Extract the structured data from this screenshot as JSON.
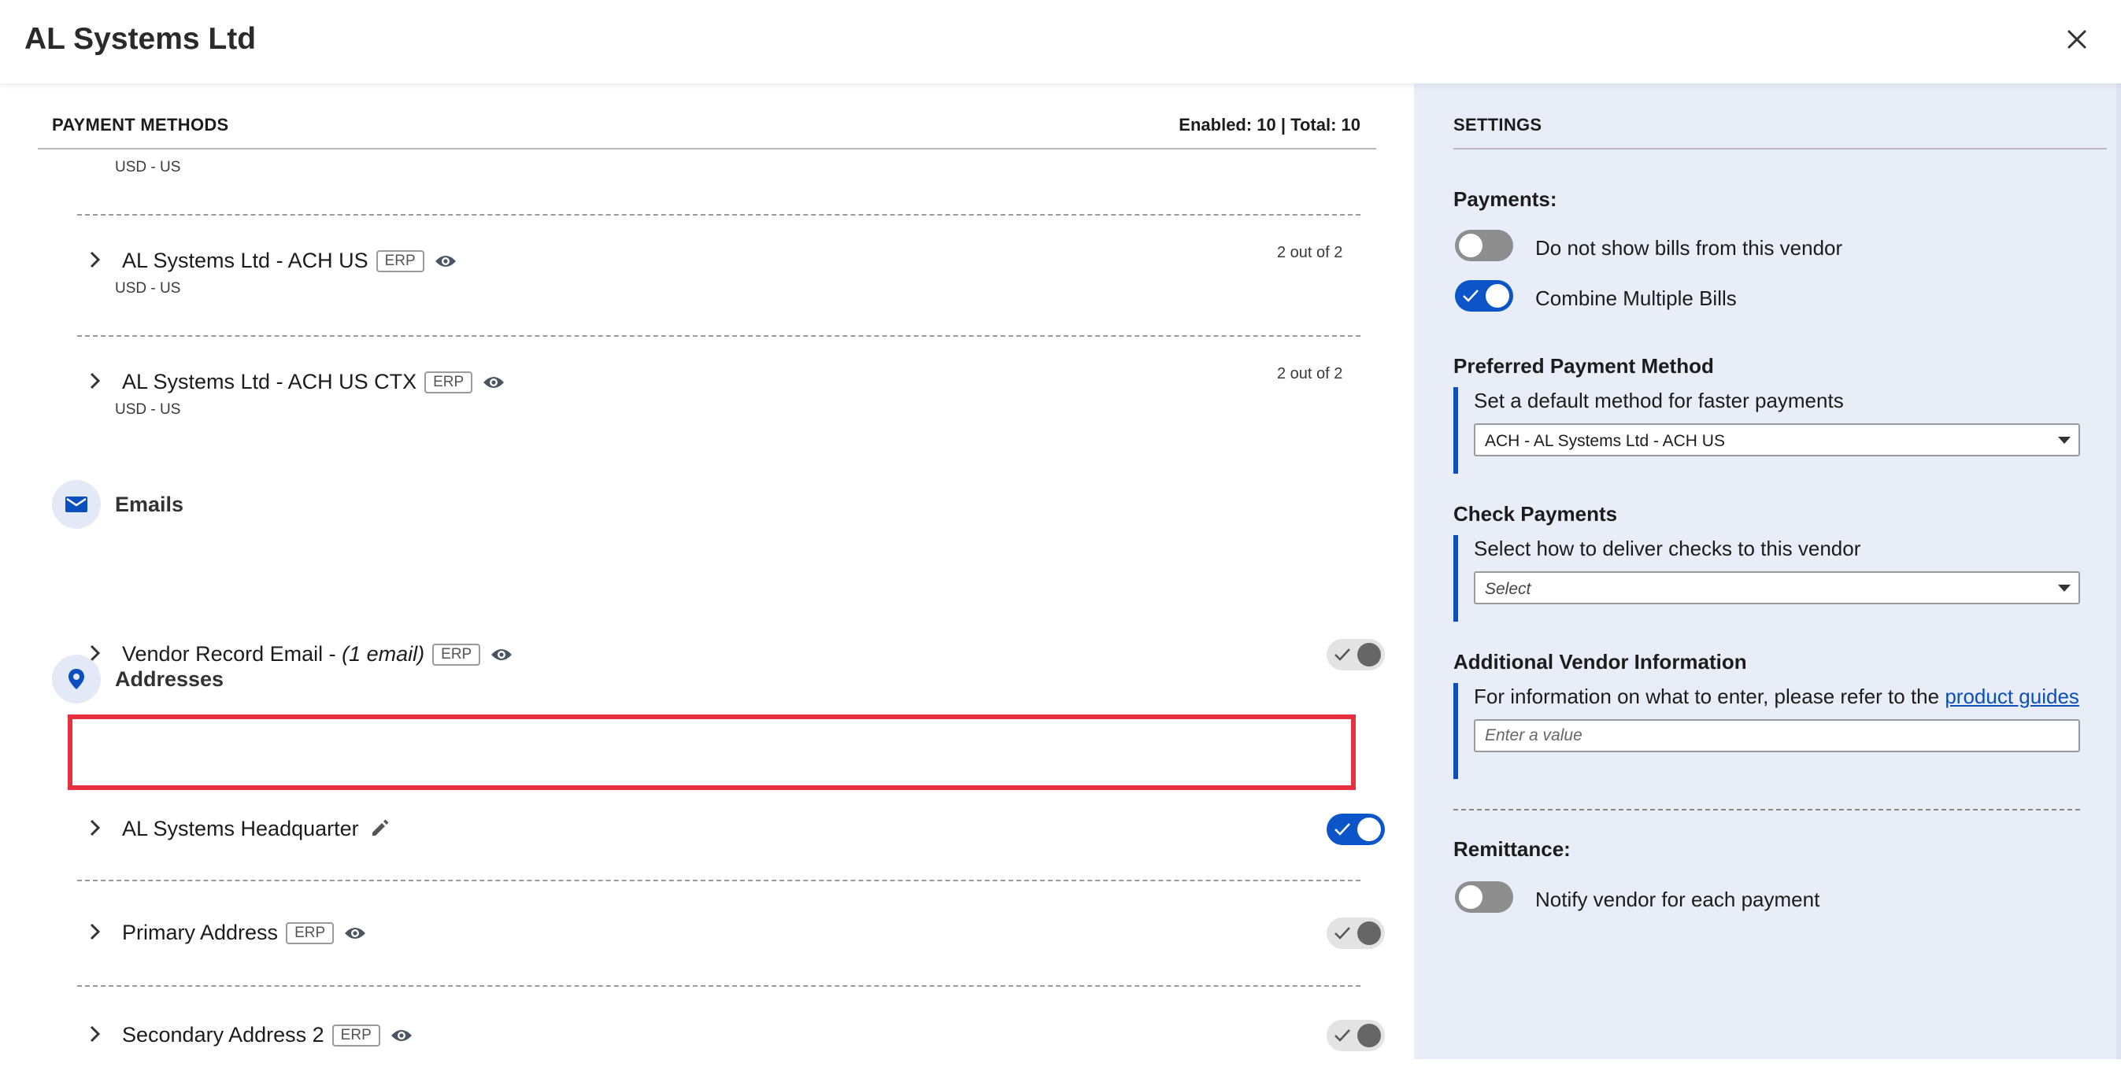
{
  "header": {
    "title": "AL Systems Ltd"
  },
  "payment_methods": {
    "heading": "PAYMENT METHODS",
    "counts": "Enabled: 10  |  Total: 10",
    "partial_sub": "USD - US",
    "rows": [
      {
        "label": "AL Systems Ltd - ACH US",
        "badge": "ERP",
        "sub": "USD - US",
        "out_of": "2 out of 2"
      },
      {
        "label": "AL Systems Ltd - ACH US CTX",
        "badge": "ERP",
        "sub": "USD - US",
        "out_of": "2 out of 2"
      }
    ]
  },
  "emails": {
    "heading": "Emails",
    "rows": [
      {
        "label": "Vendor Record Email - ",
        "label_italic": "(1 email)",
        "badge": "ERP"
      }
    ]
  },
  "addresses": {
    "heading": "Addresses",
    "rows": [
      {
        "label": "AL Systems Headquarter",
        "enabled": true
      },
      {
        "label": "Primary Address",
        "badge": "ERP"
      },
      {
        "label": "Secondary Address 2",
        "badge": "ERP"
      }
    ]
  },
  "settings": {
    "heading": "SETTINGS",
    "payments_label": "Payments:",
    "toggle_hide_bills": "Do not show bills from this vendor",
    "toggle_combine": "Combine Multiple Bills",
    "preferred": {
      "label": "Preferred Payment Method",
      "help": "Set a default method for faster payments",
      "value": "ACH - AL Systems Ltd - ACH US"
    },
    "check": {
      "label": "Check Payments",
      "help": "Select how to deliver checks to this vendor",
      "value": "Select"
    },
    "additional": {
      "label": "Additional Vendor Information",
      "help": "For information on what to enter, please refer to the ",
      "link": "product guides",
      "placeholder": "Enter a value"
    },
    "remittance_label": "Remittance:",
    "toggle_notify": "Notify vendor for each payment"
  },
  "colors": {
    "accent": "#0b55c8",
    "highlight": "#e63040",
    "settings_bg": "#e8edf8"
  }
}
